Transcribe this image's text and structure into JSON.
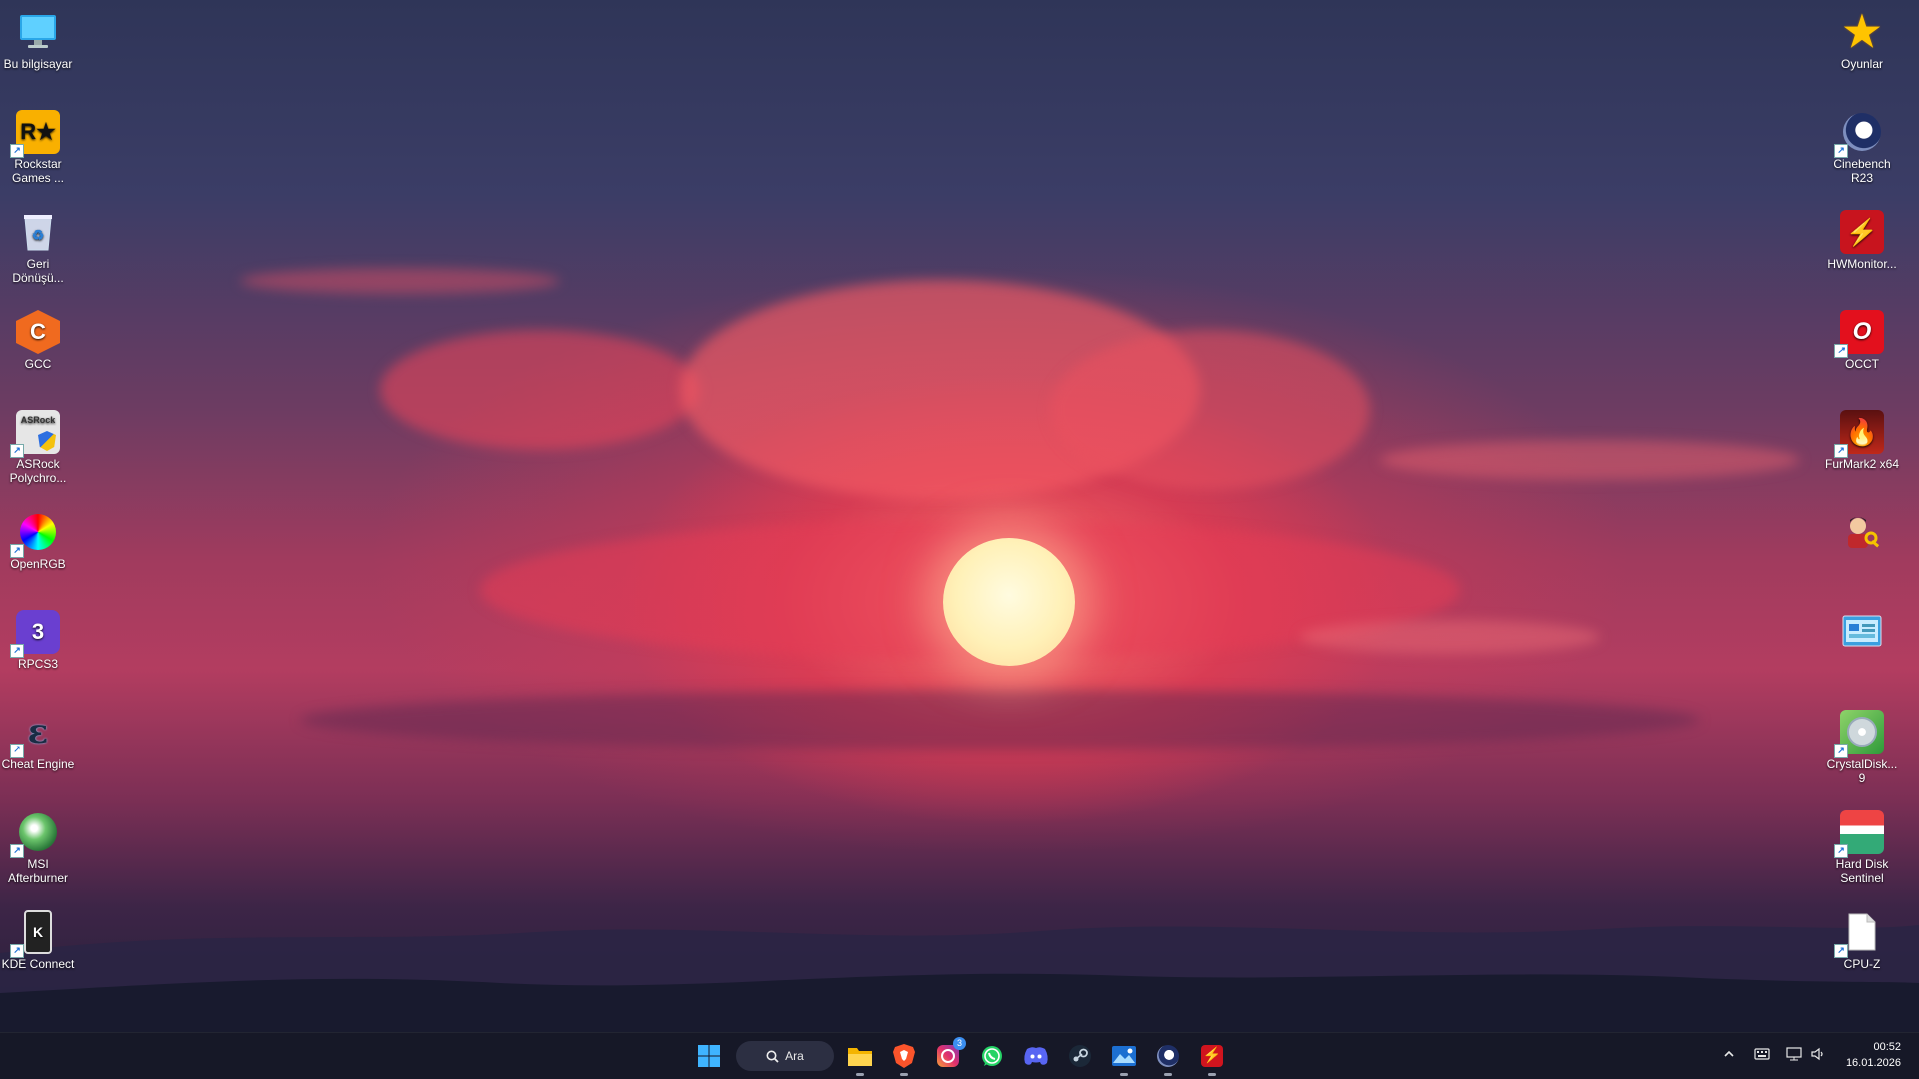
{
  "desktop": {
    "left_icons": [
      {
        "label": "Bu bilgisayar",
        "icon": "computer-icon"
      },
      {
        "label": "Rockstar Games ...",
        "icon": "rockstar-icon"
      },
      {
        "label": "Geri Dönüşü...",
        "icon": "recycle-bin-icon"
      },
      {
        "label": "GCC",
        "icon": "gcc-icon"
      },
      {
        "label": "ASRock Polychro...",
        "icon": "asrock-icon"
      },
      {
        "label": "OpenRGB",
        "icon": "openrgb-icon"
      },
      {
        "label": "RPCS3",
        "icon": "rpcs3-icon"
      },
      {
        "label": "Cheat Engine",
        "icon": "cheat-engine-icon"
      },
      {
        "label": "MSI Afterburner",
        "icon": "msi-afterburner-icon"
      },
      {
        "label": "KDE Connect",
        "icon": "kde-connect-icon"
      }
    ],
    "right_icons": [
      {
        "label": "Oyunlar",
        "icon": "star-folder-icon"
      },
      {
        "label": "Cinebench R23",
        "icon": "cinebench-icon"
      },
      {
        "label": "HWMonitor...",
        "icon": "hwmonitor-icon"
      },
      {
        "label": "OCCT",
        "icon": "occt-icon"
      },
      {
        "label": "FurMark2 x64",
        "icon": "furmark-icon"
      },
      {
        "label": "",
        "icon": "user-key-icon"
      },
      {
        "label": "",
        "icon": "control-panel-icon"
      },
      {
        "label": "CrystalDisk... 9",
        "icon": "crystaldisk-icon"
      },
      {
        "label": "Hard Disk Sentinel",
        "icon": "hard-disk-sentinel-icon"
      },
      {
        "label": "CPU-Z",
        "icon": "cpu-z-icon"
      }
    ]
  },
  "taskbar": {
    "search_label": "Ara",
    "apps": [
      {
        "icon": "file-explorer-icon"
      },
      {
        "icon": "brave-icon"
      },
      {
        "icon": "instagram-icon"
      },
      {
        "icon": "whatsapp-icon"
      },
      {
        "icon": "discord-icon"
      },
      {
        "icon": "steam-icon"
      },
      {
        "icon": "photos-icon"
      },
      {
        "icon": "cinebench-icon"
      },
      {
        "icon": "hwmonitor-icon"
      }
    ],
    "instagram_badge": "3",
    "time": "00:52",
    "date": "16.01.2026"
  },
  "colors": {
    "taskbar_bg": "#16182a",
    "accent": "#1a73e8"
  }
}
